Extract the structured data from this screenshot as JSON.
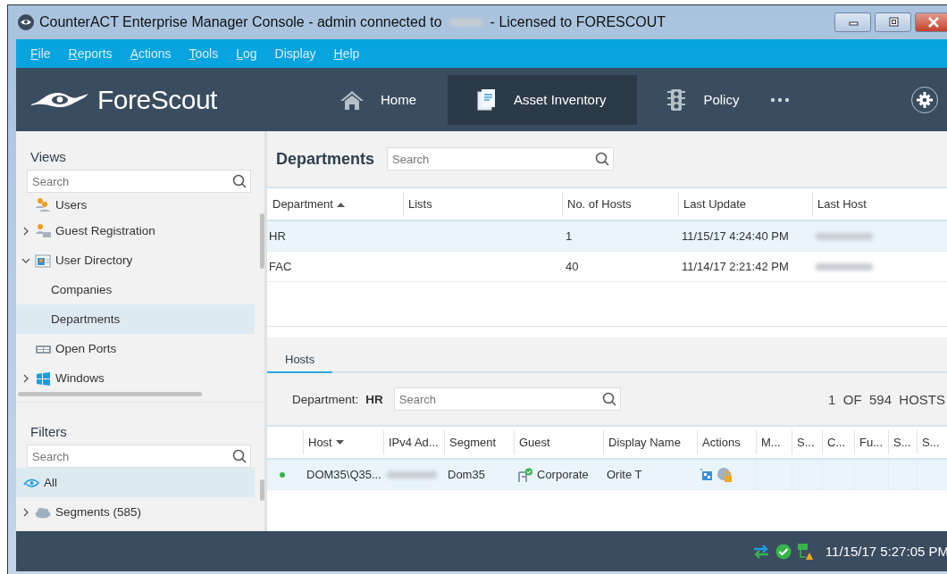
{
  "window": {
    "title_start": "CounterACT Enterprise Manager Console - admin connected to",
    "title_end": "- Licensed to FORESCOUT"
  },
  "menu": [
    {
      "label": "File",
      "underlined": true
    },
    {
      "label": "Reports",
      "underlined": true
    },
    {
      "label": "Actions",
      "underlined": true
    },
    {
      "label": "Tools",
      "underlined": true
    },
    {
      "label": "Log",
      "underlined": true
    },
    {
      "label": "Display",
      "underlined": false
    },
    {
      "label": "Help",
      "underlined": true
    }
  ],
  "logo": {
    "text": "ForeScout"
  },
  "nav": [
    {
      "label": "Home",
      "selected": false
    },
    {
      "label": "Asset Inventory",
      "selected": true
    },
    {
      "label": "Policy",
      "selected": false
    }
  ],
  "views": {
    "title": "Views",
    "search": {
      "placeholder": "Search"
    },
    "items": [
      {
        "label": "Users",
        "kind": "leaf",
        "selected": false
      },
      {
        "label": "Guest Registration",
        "kind": "group",
        "expanded": false,
        "selected": false
      },
      {
        "label": "User Directory",
        "kind": "group",
        "expanded": true,
        "selected": false,
        "children": [
          {
            "label": "Companies",
            "selected": false
          },
          {
            "label": "Departments",
            "selected": true
          }
        ]
      },
      {
        "label": "Open Ports",
        "kind": "leaf",
        "selected": false
      },
      {
        "label": "Windows",
        "kind": "group",
        "expanded": false,
        "selected": false
      }
    ]
  },
  "filters": {
    "title": "Filters",
    "search": {
      "placeholder": "Search"
    },
    "items": [
      {
        "label": "All",
        "kind": "root",
        "selected": true
      },
      {
        "label": "Segments (585)",
        "kind": "group",
        "expanded": false,
        "selected": false
      }
    ]
  },
  "departments": {
    "title": "Departments",
    "search": {
      "placeholder": "Search"
    },
    "sort_ascending": true,
    "columns": [
      {
        "label": "Department",
        "sorted": true
      },
      {
        "label": "Lists",
        "sorted": false
      },
      {
        "label": "No. of Hosts",
        "sorted": false
      },
      {
        "label": "Last Update",
        "sorted": false
      },
      {
        "label": "Last Host",
        "sorted": false
      }
    ],
    "rows": [
      {
        "department": "HR",
        "hosts": "1",
        "last_update": "11/15/17 4:24:40 PM",
        "selected": true
      },
      {
        "department": "FAC",
        "hosts": "40",
        "last_update": "11/14/17 2:21:42 PM",
        "selected": false
      }
    ]
  },
  "hosts": {
    "tabs": [
      {
        "label": "Hosts",
        "selected": true
      }
    ],
    "filter_label": "Department:",
    "filter_value": "HR",
    "search": {
      "placeholder": "Search"
    },
    "count": "1  OF  594  HOSTS",
    "sort_ascending": false,
    "columns": [
      {
        "label": "Host",
        "sorted": true
      },
      {
        "label": "IPv4 Ad...",
        "sorted": false
      },
      {
        "label": "Segment",
        "sorted": false
      },
      {
        "label": "Guest",
        "sorted": false
      },
      {
        "label": "Display Name",
        "sorted": false
      },
      {
        "label": "Actions",
        "sorted": false
      },
      {
        "label": "M...",
        "sorted": false
      },
      {
        "label": "S...",
        "sorted": false
      },
      {
        "label": "C...",
        "sorted": false
      },
      {
        "label": "Fu...",
        "sorted": false
      },
      {
        "label": "S...",
        "sorted": false
      },
      {
        "label": "S...",
        "sorted": false
      }
    ],
    "rows": [
      {
        "online": true,
        "host": "DOM35\\Q35...",
        "segment": "Dom35",
        "guest": "Corporate",
        "display_name": "Orite T",
        "selected": true
      }
    ]
  },
  "status_bar": {
    "time": "11/15/17 5:27:05 PM"
  }
}
